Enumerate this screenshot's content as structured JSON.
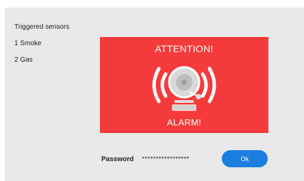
{
  "sensors": {
    "title": "Triggered sensors",
    "items": [
      {
        "label": "1 Smoke"
      },
      {
        "label": "2 Gas"
      }
    ]
  },
  "alarm": {
    "attention": "ATTENTION!",
    "alarm": "ALARM!",
    "bell_icon": "alarm-bell-icon",
    "background_color": "#f43a3a"
  },
  "password": {
    "label": "Password",
    "value": "*****************"
  },
  "ok_button": {
    "label": "Ok",
    "color": "#1c7fe0"
  }
}
